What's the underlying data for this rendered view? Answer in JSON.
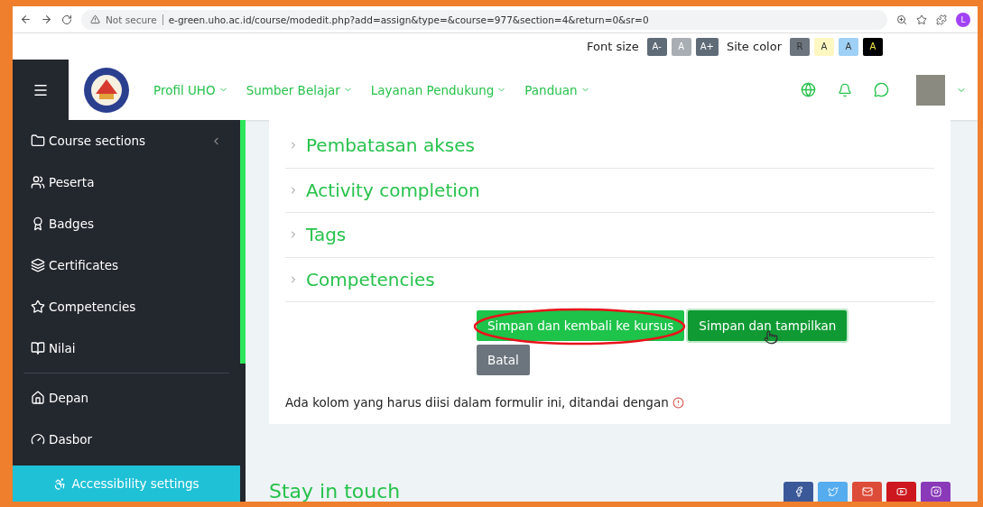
{
  "browser": {
    "security": "Not secure",
    "url": "e-green.uho.ac.id/course/modedit.php?add=assign&type=&course=977&section=4&return=0&sr=0",
    "profile_initial": "L"
  },
  "accessibility_bar": {
    "font_size_label": "Font size",
    "font_buttons": [
      {
        "label": "A-",
        "disabled": false
      },
      {
        "label": "A",
        "disabled": true
      },
      {
        "label": "A+",
        "disabled": false
      }
    ],
    "site_color_label": "Site color",
    "color_buttons": [
      {
        "label": "R",
        "color": "#6c757d"
      },
      {
        "label": "A",
        "color": "#fff7c2"
      },
      {
        "label": "A",
        "color": "#9fd0f5"
      },
      {
        "label": "A",
        "color": "#000000"
      }
    ]
  },
  "navbar": {
    "menu": [
      {
        "label": "Profil UHO"
      },
      {
        "label": "Sumber Belajar"
      },
      {
        "label": "Layanan Pendukung"
      },
      {
        "label": "Panduan"
      }
    ]
  },
  "sidebar": {
    "items": [
      {
        "label": "Course sections",
        "kind": "folder",
        "collapsible": true
      },
      {
        "label": "Peserta",
        "kind": "users",
        "collapsible": false
      },
      {
        "label": "Badges",
        "kind": "badge",
        "collapsible": false
      },
      {
        "label": "Certificates",
        "kind": "layers",
        "collapsible": false
      },
      {
        "label": "Competencies",
        "kind": "star",
        "collapsible": false
      },
      {
        "label": "Nilai",
        "kind": "book",
        "collapsible": false
      }
    ],
    "bottom_items": [
      {
        "label": "Depan",
        "kind": "home"
      },
      {
        "label": "Dasbor",
        "kind": "gauge"
      }
    ],
    "accessibility_button": "Accessibility settings"
  },
  "form": {
    "sections": [
      {
        "label": "Pembatasan akses",
        "expanded": false
      },
      {
        "label": "Activity completion",
        "expanded": false
      },
      {
        "label": "Tags",
        "expanded": false
      },
      {
        "label": "Competencies",
        "expanded": false
      }
    ],
    "buttons": [
      {
        "label": "Simpan dan kembali ke kursus",
        "kind": "primary",
        "annotated": true
      },
      {
        "label": "Simpan dan tampilkan",
        "kind": "secondary",
        "annotated": false,
        "hovered": true
      },
      {
        "label": "Batal",
        "kind": "cancel",
        "annotated": false
      }
    ],
    "required_note": "Ada kolom yang harus diisi dalam formulir ini, ditandai dengan"
  },
  "footer": {
    "title": "Stay in touch",
    "social": [
      {
        "color": "#3b5998"
      },
      {
        "color": "#55acee"
      },
      {
        "color": "#dd4b39"
      },
      {
        "color": "#cc181e"
      },
      {
        "color": "#8a3ab9"
      }
    ]
  }
}
